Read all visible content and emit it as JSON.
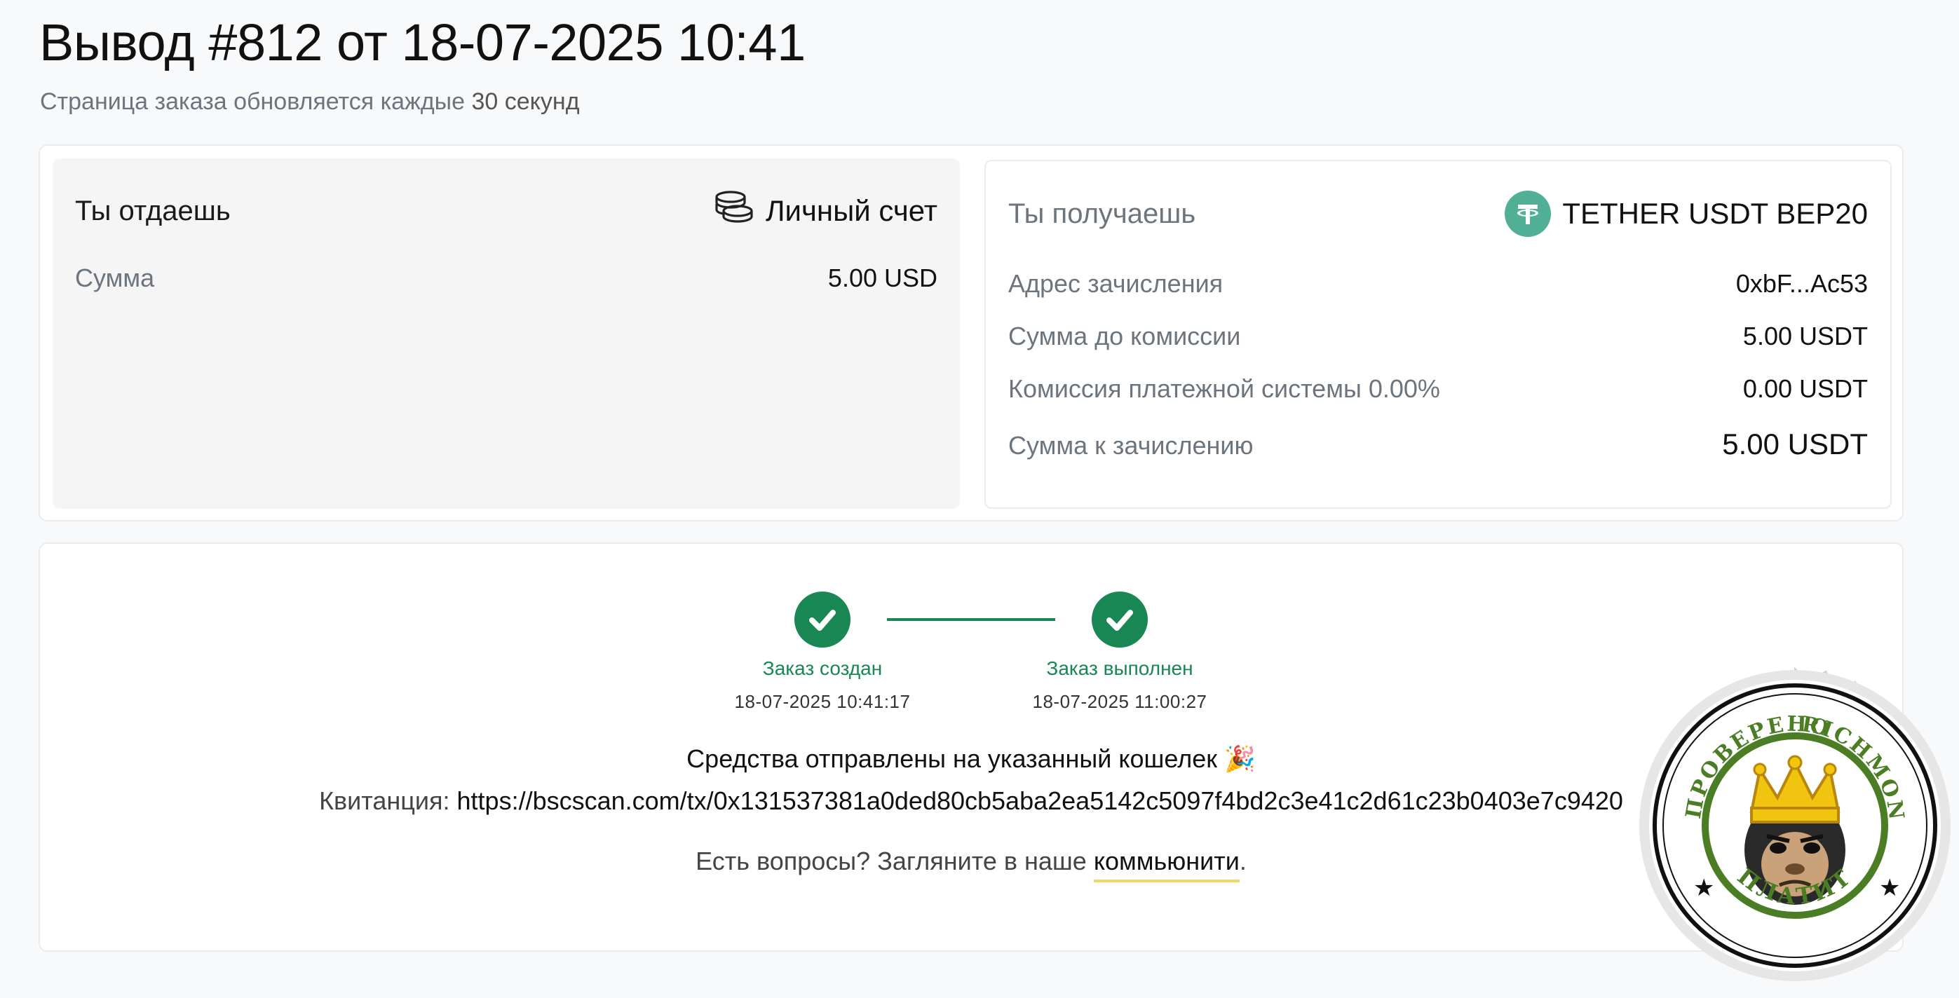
{
  "header": {
    "title": "Вывод #812 от 18-07-2025 10:41",
    "subtitle_prefix": "Страница заказа обновляется каждые ",
    "subtitle_value": "30 секунд"
  },
  "give": {
    "label": "Ты отдаешь",
    "method_icon": "coins-icon",
    "method": "Личный счет",
    "rows": [
      {
        "key": "Сумма",
        "value": "5.00 USD"
      }
    ]
  },
  "get": {
    "label": "Ты получаешь",
    "method_icon": "tether-icon",
    "method": "TETHER USDT BEP20",
    "rows": [
      {
        "key": "Адрес зачисления",
        "value": "0xbF...Ac53"
      },
      {
        "key": "Сумма до комиссии",
        "value": "5.00 USDT"
      },
      {
        "key": "Комиссия платежной системы 0.00%",
        "value": "0.00 USDT"
      },
      {
        "key": "Сумма к зачислению",
        "value": "5.00 USDT"
      }
    ]
  },
  "status": {
    "steps": [
      {
        "label": "Заказ создан",
        "time": "18-07-2025 10:41:17",
        "icon": "check-icon"
      },
      {
        "label": "Заказ выполнен",
        "time": "18-07-2025 11:00:27",
        "icon": "check-icon"
      }
    ],
    "message": "Средства отправлены на указанный кошелек 🎉",
    "receipt_label": "Квитанция:",
    "receipt_url": "https://bscscan.com/tx/0x131537381a0ded80cb5aba2ea5142c5097f4bd2c3e41c2d61c23b0403e7c9420",
    "questions_prefix": "Есть вопросы? Загляните в наше",
    "community_link": "коммьюнити",
    "questions_suffix": "."
  },
  "stamp": {
    "top_left_text": "ПРОВЕРЕНО",
    "top_right_text": "RICHMONKEY",
    "bottom_text": "ПЛАТИТ",
    "icon": "crowned-monkey-icon"
  },
  "colors": {
    "success": "#198754",
    "tether": "#50af95",
    "link_underline": "#f3d66a",
    "stamp_green": "#4a7d24"
  }
}
